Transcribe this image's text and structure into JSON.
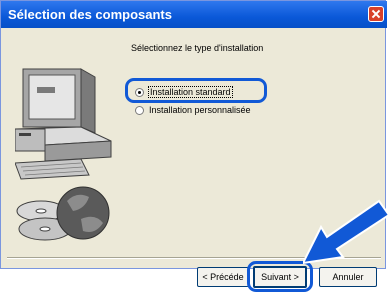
{
  "window": {
    "title": "Sélection des composants"
  },
  "content": {
    "heading": "Sélectionnez le type d'installation",
    "options": [
      {
        "label": "Installation standard",
        "selected": true
      },
      {
        "label": "Installation personnalisée",
        "selected": false
      }
    ]
  },
  "buttons": {
    "back": "< Précéde",
    "next": "Suivant >",
    "cancel": "Annuler"
  },
  "colors": {
    "highlight": "#1159d6",
    "titlebar": "#0a58d8",
    "dialog_bg": "#ece9d8"
  },
  "icons": [
    "computer-illustration",
    "cd-disc-icon",
    "globe-icon",
    "pointer-arrow-icon",
    "close-icon"
  ]
}
